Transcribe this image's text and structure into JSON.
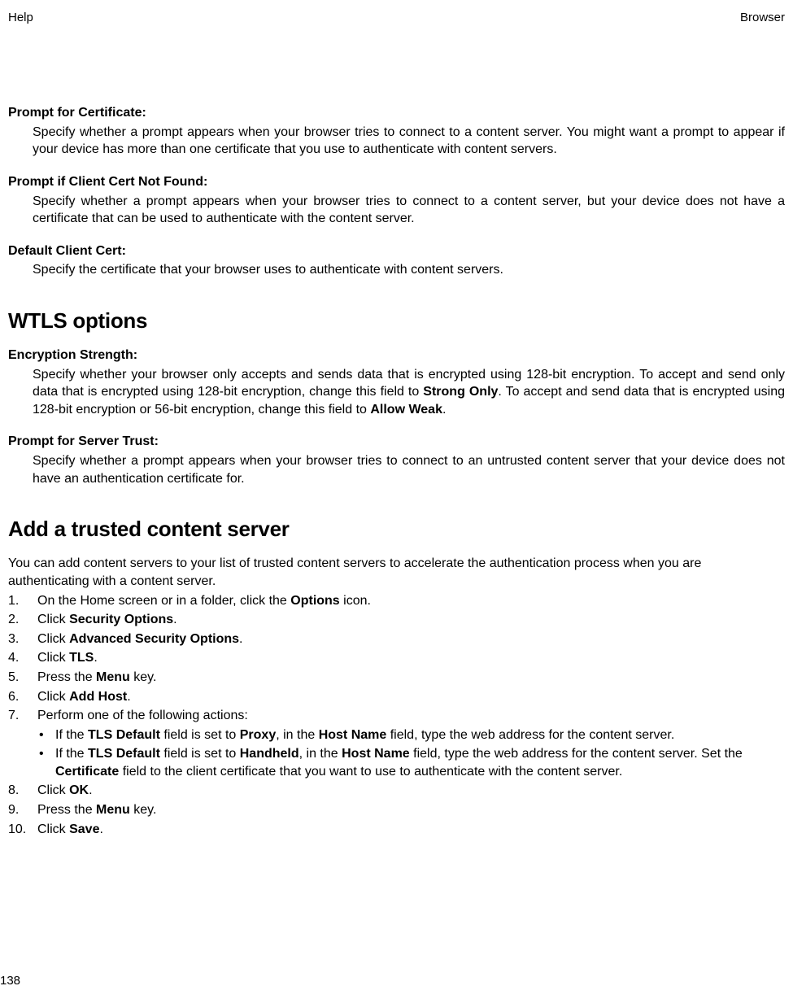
{
  "header": {
    "left": "Help",
    "right": "Browser"
  },
  "pageNumber": "138",
  "defs": {
    "promptForCertificate": {
      "term": "Prompt for Certificate",
      "body": "Specify whether a prompt appears when your browser tries to connect to a content server. You might want a prompt to appear if your device has more than one certificate that you use to authenticate with content servers."
    },
    "promptIfNotFound": {
      "term": "Prompt if Client Cert Not Found",
      "body": "Specify whether a prompt appears when your browser tries to connect to a content server, but your device does not have a certificate that can be used to authenticate with the content server."
    },
    "defaultClientCert": {
      "term": "Default Client Cert",
      "body": "Specify the certificate that your browser uses to authenticate with content servers."
    },
    "encryptionStrength": {
      "term": "Encryption Strength",
      "body_pre": "Specify whether your browser only accepts and sends data that is encrypted using 128-bit encryption. To accept and send only data that is encrypted using 128-bit encryption, change this field to ",
      "strongOnly": "Strong Only",
      "body_mid": ". To accept and send data that is encrypted using 128-bit encryption or 56-bit encryption, change this field to ",
      "allowWeak": "Allow Weak",
      "body_end": "."
    },
    "promptServerTrust": {
      "term": "Prompt for Server Trust",
      "body": "Specify whether a prompt appears when your browser tries to connect to an untrusted content server that your device does not have an authentication certificate for."
    }
  },
  "headings": {
    "wtls": "WTLS options",
    "addTrusted": "Add a trusted content server"
  },
  "addTrusted": {
    "intro": "You can add content servers to your list of trusted content servers to accelerate the authentication process when you are authenticating with a content server.",
    "steps": {
      "s1_pre": "On the Home screen or in a folder, click the ",
      "s1_b": "Options",
      "s1_post": " icon.",
      "s2_pre": "Click ",
      "s2_b": "Security Options",
      "s2_post": ".",
      "s3_pre": "Click ",
      "s3_b": "Advanced Security Options",
      "s3_post": ".",
      "s4_pre": "Click ",
      "s4_b": "TLS",
      "s4_post": ".",
      "s5_pre": "Press the ",
      "s5_b": "Menu",
      "s5_post": " key.",
      "s6_pre": "Click ",
      "s6_b": "Add Host",
      "s6_post": ".",
      "s7_text": "Perform one of the following actions:",
      "s7a_1": "If the ",
      "s7a_2": "TLS Default",
      "s7a_3": " field is set to ",
      "s7a_4": "Proxy",
      "s7a_5": ", in the ",
      "s7a_6": "Host Name",
      "s7a_7": " field, type the web address for the content server.",
      "s7b_1": "If the ",
      "s7b_2": "TLS Default",
      "s7b_3": " field is set to ",
      "s7b_4": "Handheld",
      "s7b_5": ", in the ",
      "s7b_6": "Host Name",
      "s7b_7": " field, type the web address for the content server. Set the ",
      "s7b_8": "Certificate",
      "s7b_9": " field to the client certificate that you want to use to authenticate with the content server.",
      "s8_pre": "Click ",
      "s8_b": "OK",
      "s8_post": ".",
      "s9_pre": "Press the ",
      "s9_b": "Menu",
      "s9_post": " key.",
      "s10_pre": "Click ",
      "s10_b": "Save",
      "s10_post": "."
    }
  }
}
